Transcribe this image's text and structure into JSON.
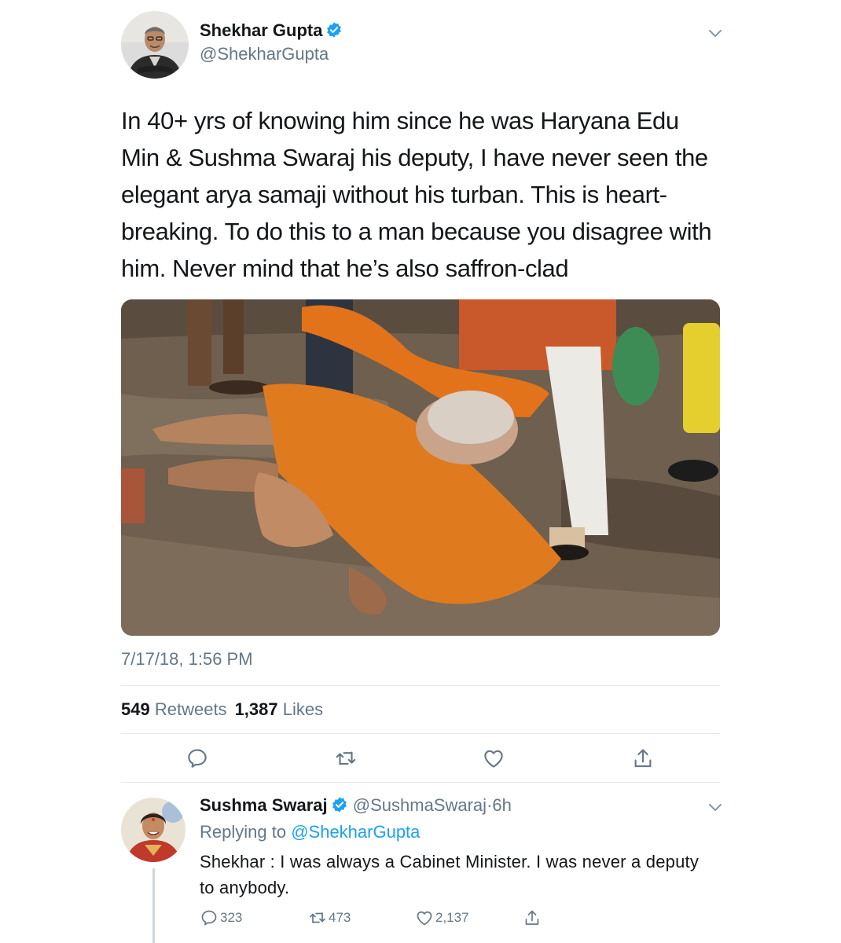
{
  "tweet": {
    "author_name": "Shekhar Gupta",
    "author_handle": "@ShekharGupta",
    "lines": [
      "In 40+ yrs of knowing him since he was Haryana Edu",
      "Min & Sushma Swaraj his deputy, I have never seen the",
      "elegant arya samaji without his turban. This is heart-",
      "breaking. To do this to a man because you disagree with",
      "him. Never mind that he’s also saffron-clad"
    ],
    "timestamp": "7/17/18, 1:56 PM",
    "retweets_count": "549",
    "retweets_label": "Retweets",
    "likes_count": "1,387",
    "likes_label": "Likes"
  },
  "actions": [
    "reply-icon",
    "retweet-icon",
    "like-icon",
    "share-icon"
  ],
  "reply": {
    "author_name": "Sushma Swaraj",
    "author_handle": "@SushmaSwaraj",
    "separator": "·",
    "time": "6h",
    "replying_label": "Replying to",
    "replying_to": "@ShekharGupta",
    "text": "Shekhar : I was always a Cabinet Minister. I was never a deputy to anybody.",
    "reply_count": "323",
    "retweet_count": "473",
    "like_count": "2,137"
  },
  "colors": {
    "accent": "#1da1f2",
    "secondary_text": "#657786",
    "divider": "#e1e8ed"
  }
}
